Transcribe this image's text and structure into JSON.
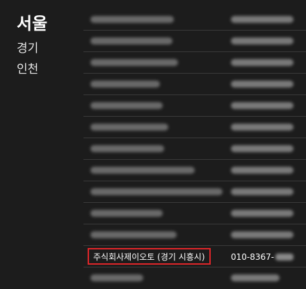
{
  "regions": [
    {
      "label": "서울",
      "active": true
    },
    {
      "label": "경기",
      "active": false
    },
    {
      "label": "인천",
      "active": false
    }
  ],
  "highlighted_entry": {
    "name": "주식회사제이오토 (경기 시흥시)",
    "phone_visible": "010-8367-"
  },
  "colors": {
    "background": "#1c1c1c",
    "highlight_border": "#e0262a"
  }
}
